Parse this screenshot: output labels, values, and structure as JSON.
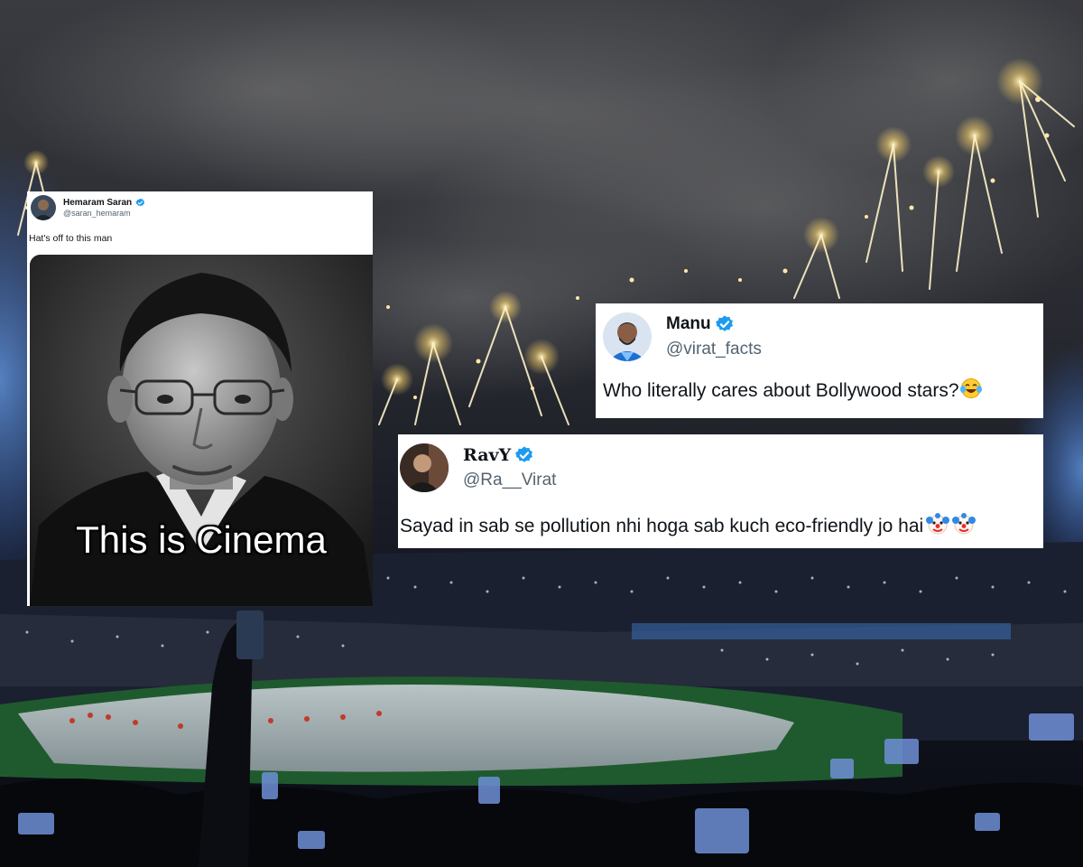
{
  "tweets": [
    {
      "name": "Hemaram Saran",
      "handle": "@saran_hemaram",
      "text": "Hat's off to this man",
      "image_caption": "This is Cinema",
      "verified": true
    },
    {
      "name": "Manu",
      "handle": "@virat_facts",
      "text": "Who literally cares about Bollywood stars?",
      "emoji": "face-with-tears-of-joy",
      "verified": true
    },
    {
      "name": "RavY",
      "handle": "@Ra__Virat",
      "text": "Sayad in sab se pollution nhi hoga sab kuch eco-friendly jo hai",
      "emoji": "clown-face x2",
      "verified": true
    }
  ],
  "colors": {
    "verified_blue": "#1d9bf0",
    "handle_gray": "#536471",
    "sky": "#2a2c33",
    "firework": "#ffe9a8"
  }
}
